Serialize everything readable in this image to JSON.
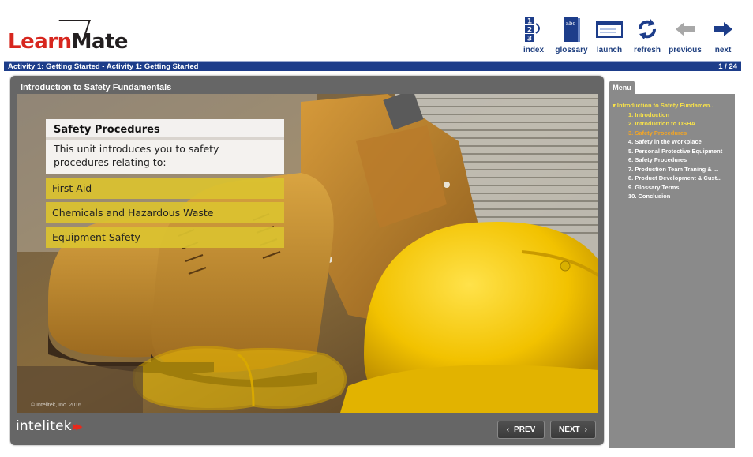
{
  "app": {
    "brand_red": "LearnMate",
    "brand_learn": "Learn",
    "brand_mate": "Mate"
  },
  "toolbar": [
    {
      "label": "index",
      "icon": "index-icon"
    },
    {
      "label": "glossary",
      "icon": "glossary-book-icon"
    },
    {
      "label": "launch",
      "icon": "launch-window-icon"
    },
    {
      "label": "refresh",
      "icon": "refresh-icon"
    },
    {
      "label": "previous",
      "icon": "arrow-left-icon"
    },
    {
      "label": "next",
      "icon": "arrow-right-icon"
    }
  ],
  "statusbar": {
    "breadcrumb": "Activity 1: Getting Started - Activity 1: Getting Started",
    "page": "1 / 24"
  },
  "player": {
    "title": "Introduction to Safety Fundamentals",
    "copyright": "© Intelitek, Inc. 2016",
    "brand": "intelitek",
    "prev_label": "PREV",
    "next_label": "NEXT"
  },
  "slide": {
    "heading": "Safety Procedures",
    "intro": "This unit introduces you to safety procedures relating to:",
    "topics": [
      "First Aid",
      "Chemicals and Hazardous Waste",
      "Equipment Safety"
    ]
  },
  "menu": {
    "tab_label": "Menu",
    "root": "Introduction to Safety Fundamen...",
    "items": [
      "1. Introduction",
      "2. Introduction to OSHA",
      "3. Safety Procedures",
      "4. Safety in the Workplace",
      "5. Personal Protective Equipment",
      "6. Safety Procedures",
      "7. Production Team Traning & ...",
      "8. Product Development & Cust...",
      "9. Glossary Terms",
      "10. Conclusion"
    ],
    "visited": [
      0,
      1
    ],
    "current": 2
  },
  "colors": {
    "accent_blue": "#1d3d8a",
    "brand_red": "#d7261e",
    "topic_yellow": "#dac22f",
    "menu_current": "#f5a623",
    "menu_visited": "#f7e14a"
  }
}
